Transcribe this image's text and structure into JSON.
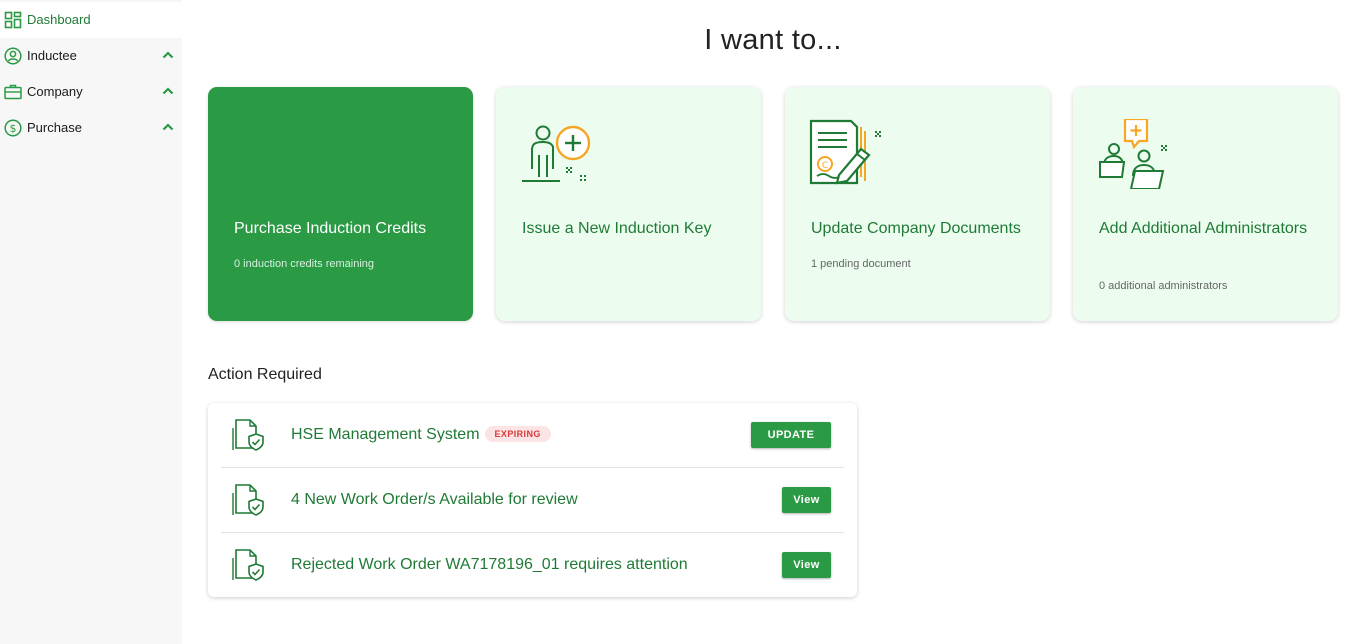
{
  "sidebar": {
    "items": [
      {
        "label": "Dashboard",
        "icon": "dashboard-grid-icon",
        "active": true
      },
      {
        "label": "Inductee",
        "icon": "user-circle-icon"
      },
      {
        "label": "Company",
        "icon": "briefcase-icon"
      },
      {
        "label": "Purchase",
        "icon": "dollar-circle-icon"
      }
    ]
  },
  "heading": "I want to...",
  "cards": [
    {
      "title": "Purchase Induction Credits",
      "subtitle": "0  induction credits remaining"
    },
    {
      "title": "Issue a New Induction Key",
      "icon": "user-plus-illustration-icon"
    },
    {
      "title": "Update Company Documents",
      "subtitle": "1 pending document",
      "icon": "document-edit-illustration-icon"
    },
    {
      "title": "Add Additional Administrators",
      "subtitle": "0 additional administrators",
      "icon": "admin-users-illustration-icon"
    }
  ],
  "action_required": {
    "title": "Action Required",
    "rows": [
      {
        "text": "HSE Management System",
        "badge": "EXPIRING",
        "button": "UPDATE"
      },
      {
        "text": "4 New Work Order/s Available for review",
        "button": "View"
      },
      {
        "text": "Rejected Work Order WA7178196_01 requires attention",
        "button": "View"
      }
    ]
  },
  "colors": {
    "brand_green": "#2a9a45",
    "text_green": "#1f7a35",
    "card_bg": "#ecfdf0",
    "accent_orange": "#f5a623",
    "badge_red": "#d63b3b"
  }
}
